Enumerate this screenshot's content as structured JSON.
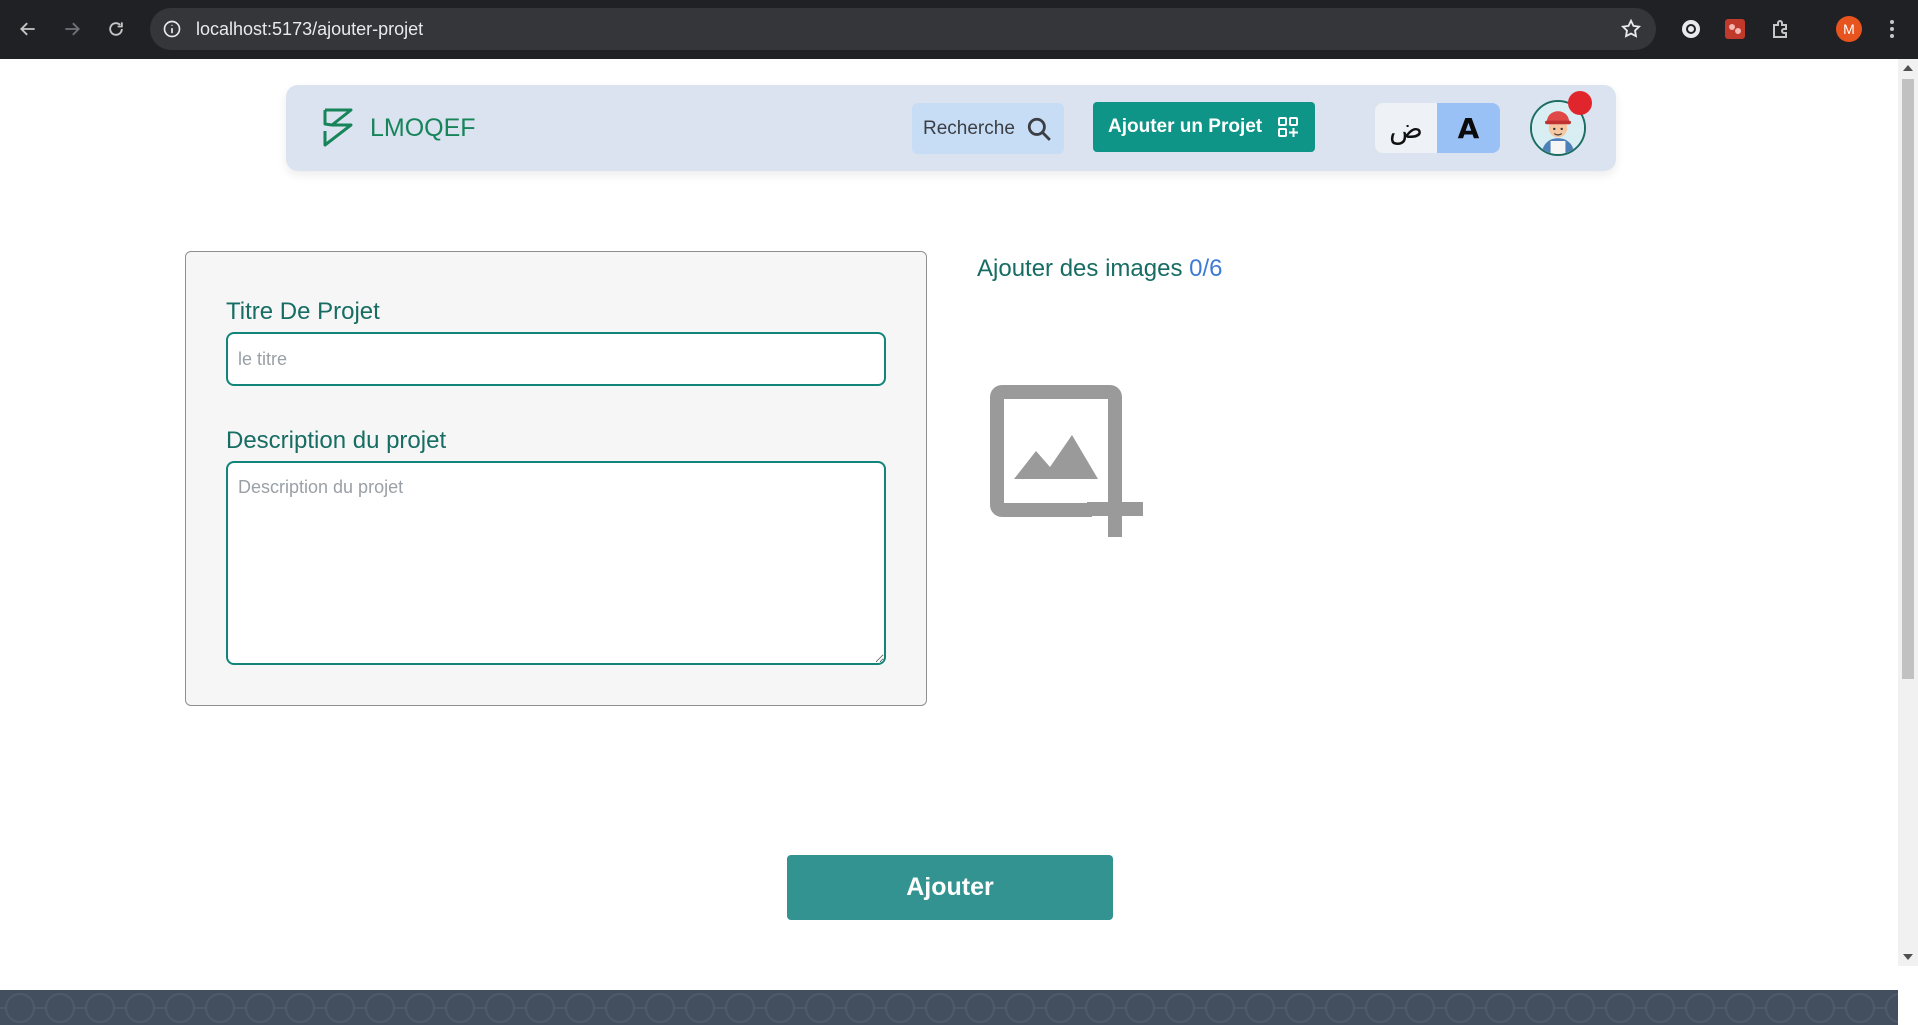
{
  "browser": {
    "url": "localhost:5173/ajouter-projet",
    "profile_initial": "M"
  },
  "header": {
    "logo_text": "LMOQEF",
    "search_label": "Recherche",
    "add_project_label": "Ajouter un Projet",
    "lang_ar": "ض",
    "lang_fr": "A"
  },
  "form": {
    "title_label": "Titre De Projet",
    "title_placeholder": "le titre",
    "title_value": "",
    "description_label": "Description du projet",
    "description_placeholder": "Description du projet",
    "description_value": ""
  },
  "images": {
    "heading": "Ajouter des images",
    "count": "0/6"
  },
  "submit_label": "Ajouter",
  "colors": {
    "brand_green": "#17845a",
    "primary_teal": "#0f9488",
    "submit_teal": "#339391",
    "label_teal": "#176d63",
    "count_blue": "#3d7bd4",
    "header_bg": "#dae3ef",
    "notification_red": "#e0262c"
  },
  "icons": {
    "back": "arrow-left-icon",
    "forward": "arrow-right-icon",
    "reload": "reload-icon",
    "site_info": "info-icon",
    "bookmark": "star-icon",
    "search": "search-icon",
    "add_project": "grid-plus-icon",
    "add_image": "add-photo-icon"
  }
}
